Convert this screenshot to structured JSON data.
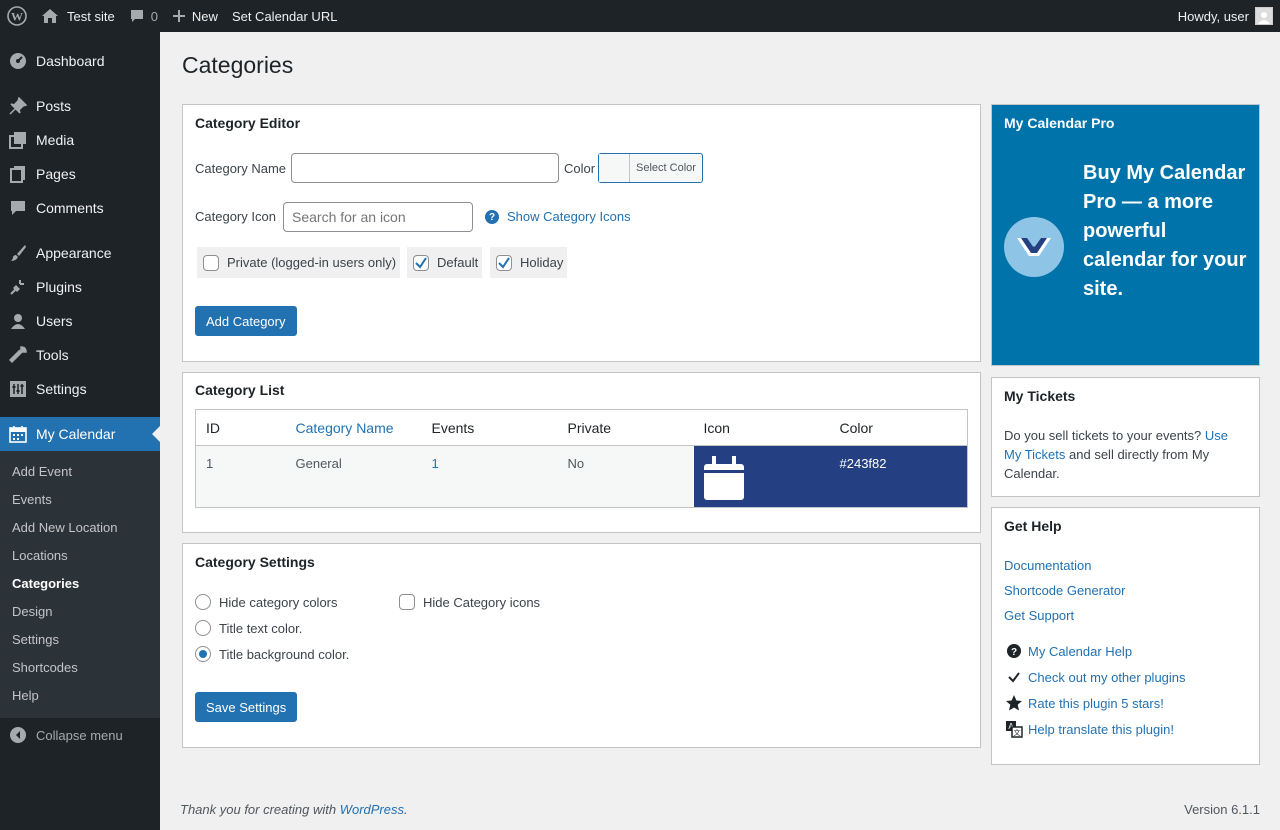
{
  "admin_bar": {
    "site_name": "Test site",
    "comments_count": "0",
    "new_label": "New",
    "calendar_url_label": "Set Calendar URL",
    "howdy": "Howdy, user"
  },
  "sidebar": {
    "items": [
      {
        "label": "Dashboard",
        "icon": "dashboard-icon"
      },
      {
        "label": "Posts",
        "icon": "pin-icon"
      },
      {
        "label": "Media",
        "icon": "media-icon"
      },
      {
        "label": "Pages",
        "icon": "pages-icon"
      },
      {
        "label": "Comments",
        "icon": "comment-icon"
      },
      {
        "label": "Appearance",
        "icon": "brush-icon"
      },
      {
        "label": "Plugins",
        "icon": "plug-icon"
      },
      {
        "label": "Users",
        "icon": "user-icon"
      },
      {
        "label": "Tools",
        "icon": "wrench-icon"
      },
      {
        "label": "Settings",
        "icon": "sliders-icon"
      },
      {
        "label": "My Calendar",
        "icon": "calendar-icon"
      }
    ],
    "submenu": [
      "Add Event",
      "Events",
      "Add New Location",
      "Locations",
      "Categories",
      "Design",
      "Settings",
      "Shortcodes",
      "Help"
    ],
    "collapse_label": "Collapse menu"
  },
  "page": {
    "title": "Categories"
  },
  "editor": {
    "heading": "Category Editor",
    "name_label": "Category Name",
    "name_value": "",
    "color_label": "Color",
    "select_color": "Select Color",
    "icon_label": "Category Icon",
    "icon_placeholder": "Search for an icon",
    "show_icons_link": "Show Category Icons",
    "checkboxes": [
      {
        "label": "Private (logged-in users only)",
        "checked": false
      },
      {
        "label": "Default",
        "checked": true
      },
      {
        "label": "Holiday",
        "checked": true
      }
    ],
    "add_button": "Add Category"
  },
  "list": {
    "heading": "Category List",
    "columns": [
      "ID",
      "Category Name",
      "Events",
      "Private",
      "Icon",
      "Color"
    ],
    "rows": [
      {
        "id": "1",
        "name": "General",
        "events": "1",
        "private": "No",
        "icon": "calendar-icon",
        "color": "#243f82"
      }
    ]
  },
  "settings": {
    "heading": "Category Settings",
    "radios": [
      {
        "label": "Hide category colors",
        "selected": false
      },
      {
        "label": "Title text color.",
        "selected": false
      },
      {
        "label": "Title background color.",
        "selected": true
      }
    ],
    "hide_icons_label": "Hide Category icons",
    "save_button": "Save Settings"
  },
  "promo": {
    "heading": "My Calendar Pro",
    "pitch_buy": "Buy ",
    "pitch_link": "My Calendar Pro",
    "pitch_rest": " — a more powerful calendar for your site."
  },
  "tickets": {
    "heading": "My Tickets",
    "text_a": "Do you sell tickets to your events? ",
    "link": "Use My Tickets",
    "text_b": " and sell directly from My Calendar."
  },
  "help": {
    "heading": "Get Help",
    "links": [
      "Documentation",
      "Shortcode Generator",
      "Get Support"
    ],
    "icon_links": [
      {
        "label": "My Calendar Help",
        "icon": "question-icon"
      },
      {
        "label": "Check out my other plugins",
        "icon": "check-icon"
      },
      {
        "label": "Rate this plugin 5 stars!",
        "icon": "star-icon"
      },
      {
        "label": "Help translate this plugin!",
        "icon": "translate-icon"
      }
    ]
  },
  "footer": {
    "thanks": "Thank you for creating with ",
    "wp_link": "WordPress",
    "period": ".",
    "version": "Version 6.1.1"
  },
  "colors": {
    "accent": "#2271b1",
    "sidebar": "#1d2327",
    "promo": "#0073aa",
    "category_color": "#243f82"
  }
}
